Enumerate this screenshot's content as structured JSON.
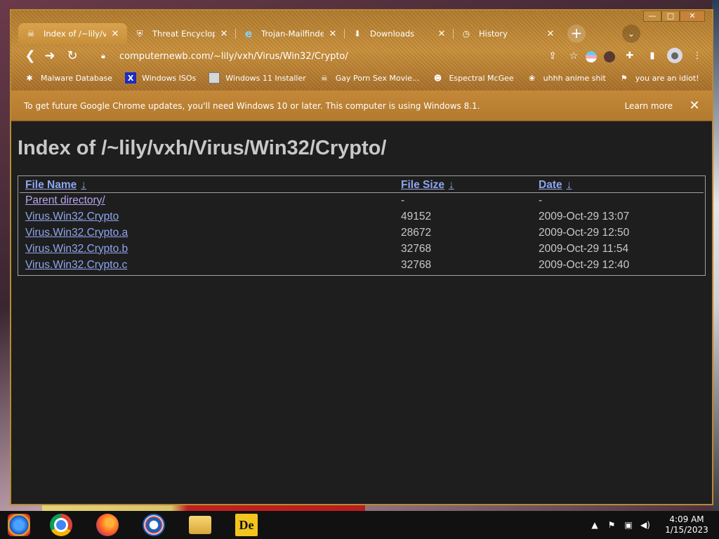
{
  "browser": {
    "window_controls": {
      "minimize": "—",
      "maximize": "□",
      "close": "✕"
    },
    "tabs": [
      {
        "title": "Index of /~lily/vxh/",
        "icon": "skull-icon",
        "active": true
      },
      {
        "title": "Threat Encyclopedia",
        "icon": "shield-icon",
        "active": false
      },
      {
        "title": "Trojan-Mailfinder",
        "icon": "ie-icon",
        "active": false
      },
      {
        "title": "Downloads",
        "icon": "download-icon",
        "active": false
      },
      {
        "title": "History",
        "icon": "history-icon",
        "active": false
      }
    ],
    "new_tab_label": "+",
    "tab_search_label": "⌄",
    "toolbar": {
      "back": "❮",
      "forward": "➜",
      "reload": "↻",
      "url": "computernewb.com/~lily/vxh/Virus/Win32/Crypto/"
    },
    "bookmarks": [
      {
        "label": "Malware Database",
        "icon": "bug-icon"
      },
      {
        "label": "Windows ISOs",
        "icon": "x-icon"
      },
      {
        "label": "Windows 11 Installer",
        "icon": "image-icon"
      },
      {
        "label": "Gay Porn Sex Movie...",
        "icon": "skull-icon"
      },
      {
        "label": "Espectral McGee",
        "icon": "face-icon"
      },
      {
        "label": "uhhh anime shit",
        "icon": "anime-icon"
      },
      {
        "label": "you are an idiot!",
        "icon": "flag-icon"
      }
    ],
    "infobar": {
      "message": "To get future Google Chrome updates, you'll need Windows 10 or later. This computer is using Windows 8.1.",
      "learn_more": "Learn more",
      "close": "✕"
    }
  },
  "page": {
    "title": "Index of /~lily/vxh/Virus/Win32/Crypto/",
    "columns": [
      {
        "label": "File Name",
        "arrow": "↓"
      },
      {
        "label": "File Size",
        "arrow": "↓"
      },
      {
        "label": "Date",
        "arrow": "↓"
      }
    ],
    "rows": [
      {
        "name": "Parent directory/",
        "size": "-",
        "date": "-"
      },
      {
        "name": "Virus.Win32.Crypto",
        "size": "49152",
        "date": "2009-Oct-29 13:07"
      },
      {
        "name": "Virus.Win32.Crypto.a",
        "size": "28672",
        "date": "2009-Oct-29 12:50"
      },
      {
        "name": "Virus.Win32.Crypto.b",
        "size": "32768",
        "date": "2009-Oct-29 11:54"
      },
      {
        "name": "Virus.Win32.Crypto.c",
        "size": "32768",
        "date": "2009-Oct-29 12:40"
      }
    ]
  },
  "taskbar": {
    "apps": [
      "windows-start-icon",
      "chrome-icon",
      "firefox-icon",
      "obama-logo-icon",
      "file-explorer-icon",
      "de-app-icon"
    ],
    "de_label": "De",
    "tray": {
      "chevron": "▲",
      "flag": "⚑",
      "network": "▣",
      "volume": "◀)"
    },
    "clock": {
      "time": "4:09 AM",
      "date": "1/15/2023"
    }
  }
}
